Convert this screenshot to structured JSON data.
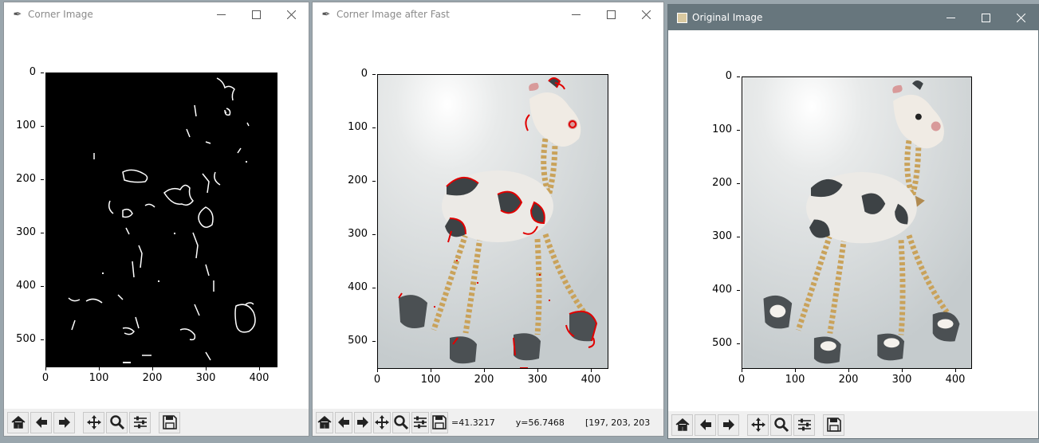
{
  "windows": [
    {
      "title": "Corner Image",
      "y_ticks": [
        "0",
        "100",
        "200",
        "300",
        "400",
        "500"
      ],
      "x_ticks": [
        "0",
        "100",
        "200",
        "300",
        "400"
      ],
      "status": {
        "x": "",
        "y": "",
        "pixel": ""
      }
    },
    {
      "title": "Corner Image after Fast",
      "y_ticks": [
        "0",
        "100",
        "200",
        "300",
        "400",
        "500"
      ],
      "x_ticks": [
        "0",
        "100",
        "200",
        "300",
        "400"
      ],
      "status": {
        "x": "=41.3217",
        "y": "y=56.7468",
        "pixel": "[197, 203, 203"
      }
    },
    {
      "title": "Original Image",
      "y_ticks": [
        "0",
        "100",
        "200",
        "300",
        "400",
        "500"
      ],
      "x_ticks": [
        "0",
        "100",
        "200",
        "300",
        "400"
      ],
      "status": {
        "x": "",
        "y": "",
        "pixel": ""
      }
    }
  ],
  "toolbar": {
    "icons": [
      "home-icon",
      "back-icon",
      "forward-icon",
      "pan-icon",
      "zoom-icon",
      "configure-icon",
      "save-icon"
    ]
  },
  "colors": {
    "active_titlebar": "#67767d",
    "inactive_titlebar": "#ffffff",
    "fast_keypoints": "#e00000",
    "edge_map_bg": "#000000"
  }
}
